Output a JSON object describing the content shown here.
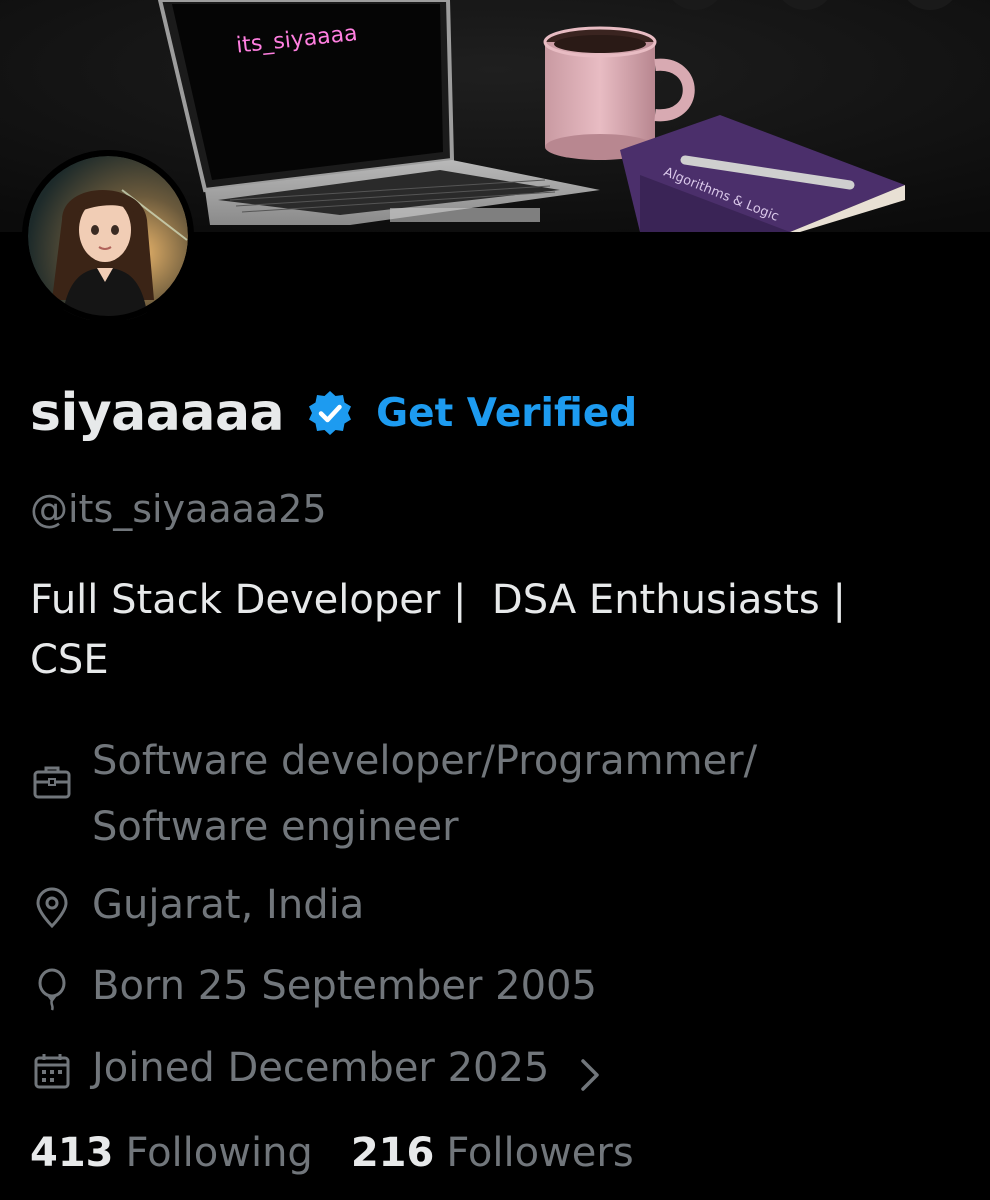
{
  "banner": {
    "screen_text": "its_siyaaaa",
    "book_text": "Algorithms & Logic"
  },
  "profile": {
    "display_name": "siyaaaaa",
    "get_verified_label": "Get Verified",
    "handle": "@its_siyaaaa25",
    "bio": "Full Stack Developer |  DSA Enthusiasts |\nCSE"
  },
  "meta": {
    "profession": "Software developer/Programmer/\nSoftware engineer",
    "location": "Gujarat, India",
    "born": "Born 25 September 2005",
    "joined": "Joined December 2025"
  },
  "icons": {
    "profession": "briefcase-icon",
    "location": "location-pin-icon",
    "born": "balloon-icon",
    "joined": "calendar-icon",
    "verified": "verified-badge-icon",
    "chevron": "chevron-right-icon"
  },
  "stats": {
    "following_count": "413",
    "following_label": "Following",
    "followers_count": "216",
    "followers_label": "Followers"
  },
  "colors": {
    "accent": "#1d9bf0",
    "secondary_text": "#71767b",
    "primary_text": "#e7e9ea",
    "background": "#000000"
  }
}
